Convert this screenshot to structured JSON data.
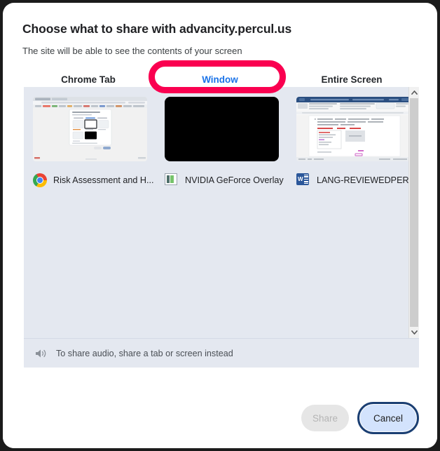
{
  "dialog": {
    "title": "Choose what to share with advancity.percul.us",
    "subtitle": "The site will be able to see the contents of your screen"
  },
  "tabs": [
    {
      "label": "Chrome Tab",
      "active": false
    },
    {
      "label": "Window",
      "active": true
    },
    {
      "label": "Entire Screen",
      "active": false
    }
  ],
  "sources": [
    {
      "label": "Risk Assessment and H...",
      "icon": "chrome-icon",
      "thumbnail": "chrome-window-preview"
    },
    {
      "label": "NVIDIA GeForce Overlay",
      "icon": "nvidia-icon",
      "thumbnail": "black-window-preview"
    },
    {
      "label": "LANG-REVIEWEDPERCU...",
      "icon": "word-icon",
      "thumbnail": "word-document-preview"
    }
  ],
  "audio_notice": {
    "icon": "speaker-icon",
    "text": "To share audio, share a tab or screen instead"
  },
  "footer": {
    "share_label": "Share",
    "cancel_label": "Cancel"
  },
  "scrollbar": {
    "up_icon": "chevron-up-icon",
    "down_icon": "chevron-down-icon"
  },
  "colors": {
    "accent": "#1a73e8",
    "annotation": "#fa0050",
    "panel_bg": "#e4e8f0",
    "cancel_bg": "#d3e3fd",
    "focus_ring": "#1b3f73"
  }
}
